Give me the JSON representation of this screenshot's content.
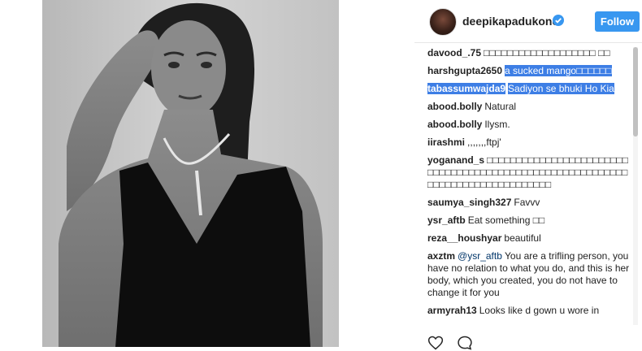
{
  "header": {
    "username": "deepikapadukone",
    "follow_label": "Follow",
    "accent_color": "#3897f0"
  },
  "comments": [
    {
      "user": "davood_.75",
      "text": "□□□□□□□□□□□□□□□□□□□ □□"
    },
    {
      "user": "harshgupta2650",
      "text": "a sucked mango□□□□□□",
      "highlight": true
    },
    {
      "user": "tabassumwajda9",
      "text": "Sadiyon se bhuki Ho Kia",
      "highlight": true
    },
    {
      "user": "abood.bolly",
      "text": "Natural"
    },
    {
      "user": "abood.bolly",
      "text": "Ilysm."
    },
    {
      "user": "iirashmi",
      "text": ",,,,,,,ftpj'"
    },
    {
      "user": "yoganand_s",
      "text": "□□□□□□□□□□□□□□□□□□□□□□□□□□□□□□□□□□□□□□□□□□□□□□□□□□□□□□□□□□□□□□□□□□□□□□□□□□□□□□□"
    },
    {
      "user": "saumya_singh327",
      "text": "Favvv"
    },
    {
      "user": "ysr_aftb",
      "text": "Eat something □□"
    },
    {
      "user": "reza__houshyar",
      "text": "beautiful"
    },
    {
      "user": "axztm",
      "mention": "@ysr_aftb",
      "text": "You are a trifling person, you have no relation to what you do, and this is her body, which you created, you do not have to change it for you"
    },
    {
      "user": "armyrah13",
      "text": "Looks like d gown u wore in"
    }
  ],
  "icons": {
    "like": "heart-icon",
    "comment": "comment-icon",
    "verified": "verified-badge-icon"
  }
}
